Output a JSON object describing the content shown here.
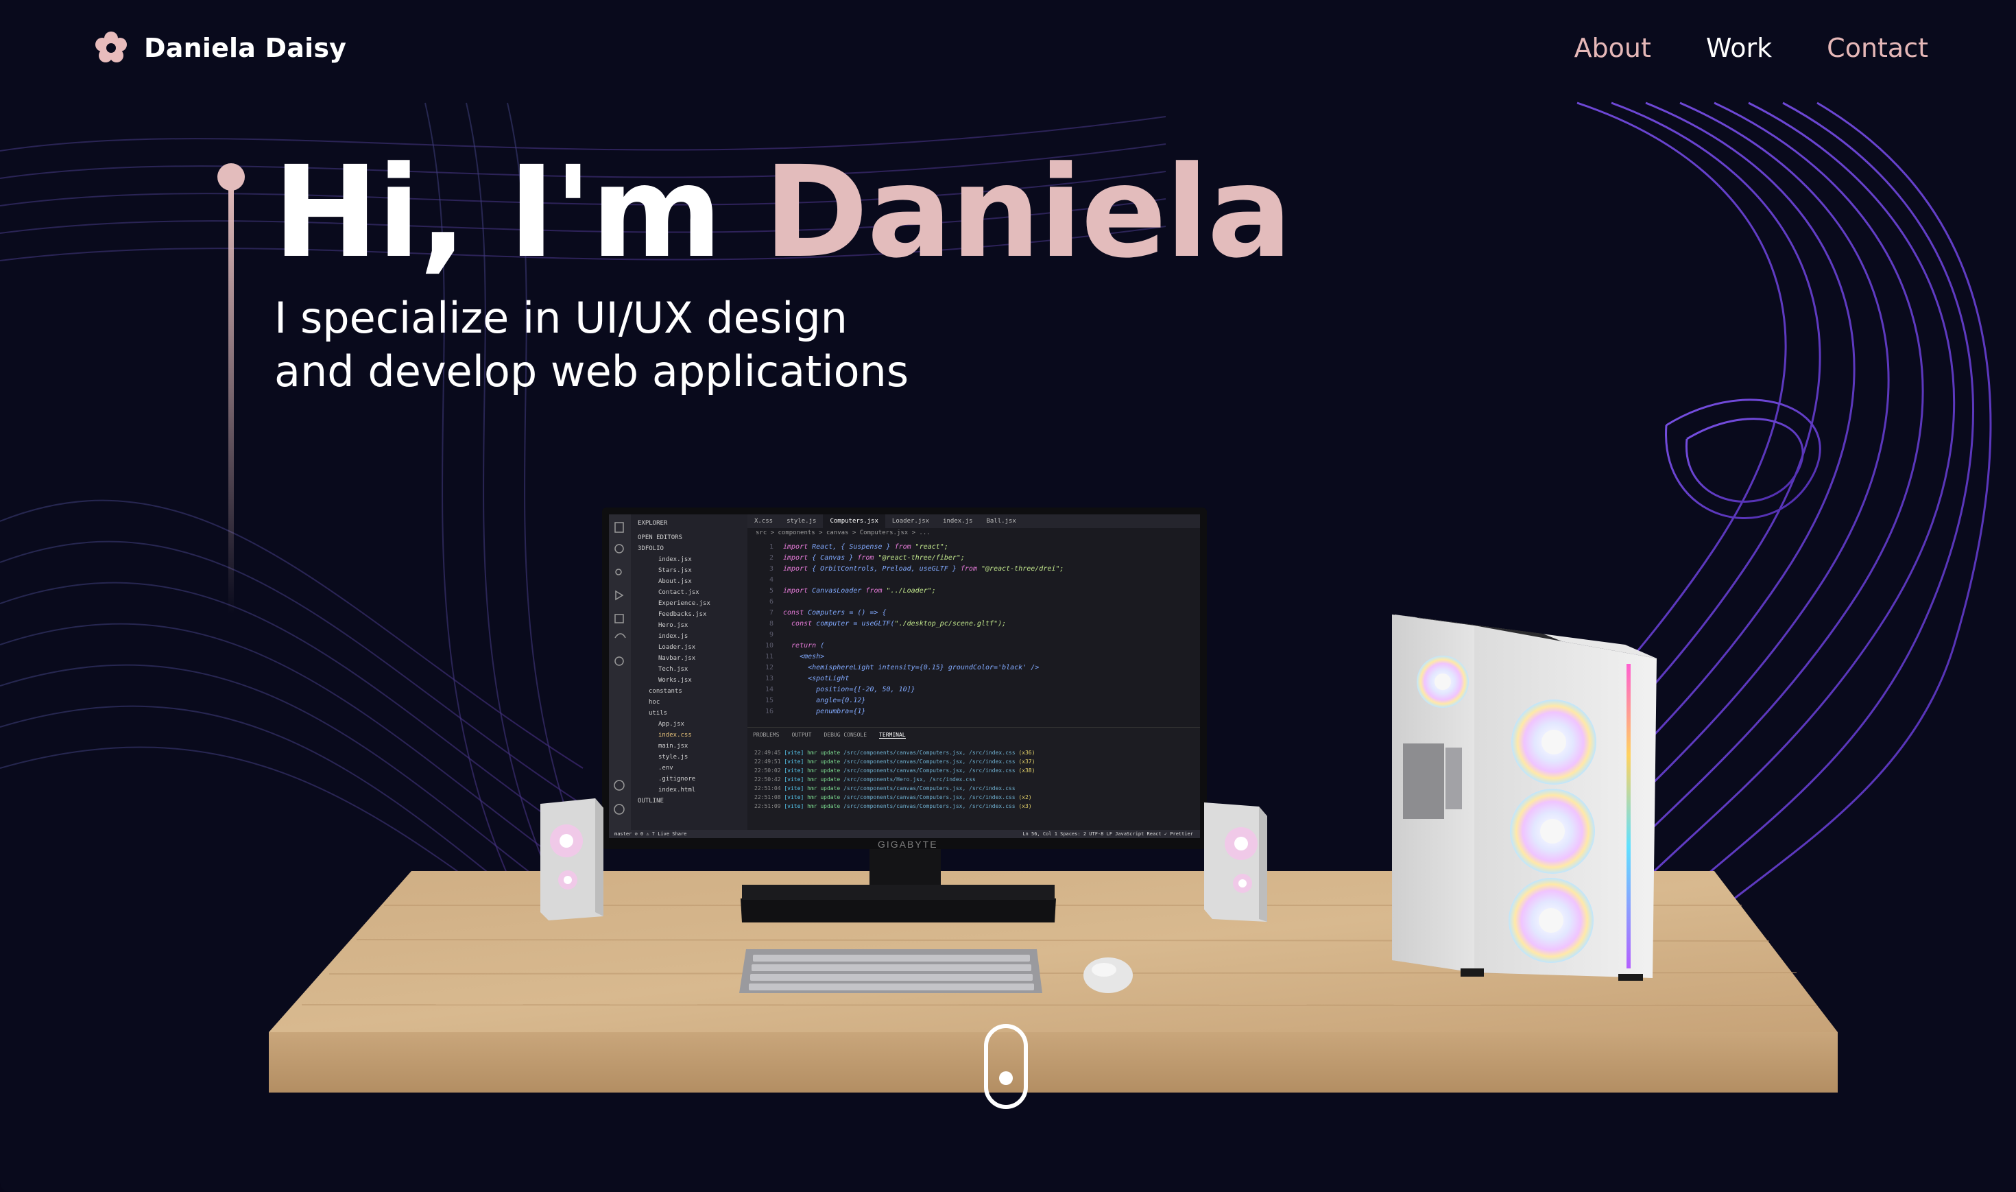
{
  "nav": {
    "brand": "Daniela Daisy",
    "links": [
      {
        "label": "About",
        "active": false
      },
      {
        "label": "Work",
        "active": true
      },
      {
        "label": "Contact",
        "active": false
      }
    ]
  },
  "hero": {
    "greeting": "Hi, I'm ",
    "name": "Daniela",
    "subtitle_line1": "I specialize in UI/UX design",
    "subtitle_line2": "and develop web applications"
  },
  "editor": {
    "explorer_title": "EXPLORER",
    "explorer_items": [
      "OPEN EDITORS",
      "3DFOLIO",
      "index.jsx",
      "Stars.jsx",
      "About.jsx",
      "Contact.jsx",
      "Experience.jsx",
      "Feedbacks.jsx",
      "Hero.jsx",
      "index.js",
      "Loader.jsx",
      "Navbar.jsx",
      "Tech.jsx",
      "Works.jsx",
      "constants",
      "hoc",
      "utils",
      "App.jsx",
      "index.css",
      "main.jsx",
      "style.js",
      ".env",
      ".gitignore",
      "index.html",
      "OUTLINE"
    ],
    "tabs": [
      "X.css",
      "style.js",
      "Computers.jsx",
      "Loader.jsx",
      "index.js",
      "Ball.jsx"
    ],
    "breadcrumb": "src > components > canvas > Computers.jsx > ...",
    "code_lines": [
      {
        "n": "1",
        "a": "import",
        "b": " React, { Suspense } ",
        "c": "from",
        "d": " \"react\";"
      },
      {
        "n": "2",
        "a": "import",
        "b": " { Canvas } ",
        "c": "from",
        "d": " \"@react-three/fiber\";"
      },
      {
        "n": "3",
        "a": "import",
        "b": " { OrbitControls, Preload, useGLTF } ",
        "c": "from",
        "d": " \"@react-three/drei\";"
      },
      {
        "n": "4",
        "a": "",
        "b": "",
        "c": "",
        "d": ""
      },
      {
        "n": "5",
        "a": "import",
        "b": " CanvasLoader ",
        "c": "from",
        "d": " \"../Loader\";"
      },
      {
        "n": "6",
        "a": "",
        "b": "",
        "c": "",
        "d": ""
      },
      {
        "n": "7",
        "a": "const",
        "b": " Computers = () => {",
        "c": "",
        "d": ""
      },
      {
        "n": "8",
        "a": "  const",
        "b": " computer = useGLTF(",
        "c": "",
        "d": "\"./desktop_pc/scene.gltf\");"
      },
      {
        "n": "9",
        "a": "",
        "b": "",
        "c": "",
        "d": ""
      },
      {
        "n": "10",
        "a": "  return",
        "b": " (",
        "c": "",
        "d": ""
      },
      {
        "n": "11",
        "a": "",
        "b": "    <mesh>",
        "c": "",
        "d": ""
      },
      {
        "n": "12",
        "a": "",
        "b": "      <hemisphereLight intensity={0.15} groundColor='black' />",
        "c": "",
        "d": ""
      },
      {
        "n": "13",
        "a": "",
        "b": "      <spotLight",
        "c": "",
        "d": ""
      },
      {
        "n": "14",
        "a": "",
        "b": "        position={[-20, 50, 10]}",
        "c": "",
        "d": ""
      },
      {
        "n": "15",
        "a": "",
        "b": "        angle={0.12}",
        "c": "",
        "d": ""
      },
      {
        "n": "16",
        "a": "",
        "b": "        penumbra={1}",
        "c": "",
        "d": ""
      }
    ],
    "panel_tabs": [
      "PROBLEMS",
      "OUTPUT",
      "DEBUG CONSOLE",
      "TERMINAL"
    ],
    "terminal_lines": [
      {
        "time": "22:49:45",
        "msg": "/src/components/canvas/Computers.jsx, /src/index.css",
        "cnt": "(x36)"
      },
      {
        "time": "22:49:51",
        "msg": "/src/components/canvas/Computers.jsx, /src/index.css",
        "cnt": "(x37)"
      },
      {
        "time": "22:50:02",
        "msg": "/src/components/canvas/Computers.jsx, /src/index.css",
        "cnt": "(x38)"
      },
      {
        "time": "22:50:42",
        "msg": "/src/components/Hero.jsx, /src/index.css",
        "cnt": ""
      },
      {
        "time": "22:51:04",
        "msg": "/src/components/canvas/Computers.jsx, /src/index.css",
        "cnt": ""
      },
      {
        "time": "22:51:08",
        "msg": "/src/components/canvas/Computers.jsx, /src/index.css",
        "cnt": "(x2)"
      },
      {
        "time": "22:51:09",
        "msg": "/src/components/canvas/Computers.jsx, /src/index.css",
        "cnt": "(x3)"
      }
    ],
    "term_tag": "[vite]",
    "term_hmr": "hmr update",
    "status_left": "master   ⊘ 0 ⚠ 7   Live Share",
    "status_right": "Ln 56, Col 1   Spaces: 2   UTF-8   LF   JavaScript React   ✓ Prettier"
  },
  "monitor_brand": "GIGABYTE",
  "colors": {
    "background": "#090a1c",
    "accent_pink": "#e3bcbc",
    "wave_purple": "#6a3fd1",
    "desk_wood": "#c8a57a"
  },
  "icons": {
    "brand": "flower-icon",
    "scroll": "mouse-scroll-icon"
  }
}
